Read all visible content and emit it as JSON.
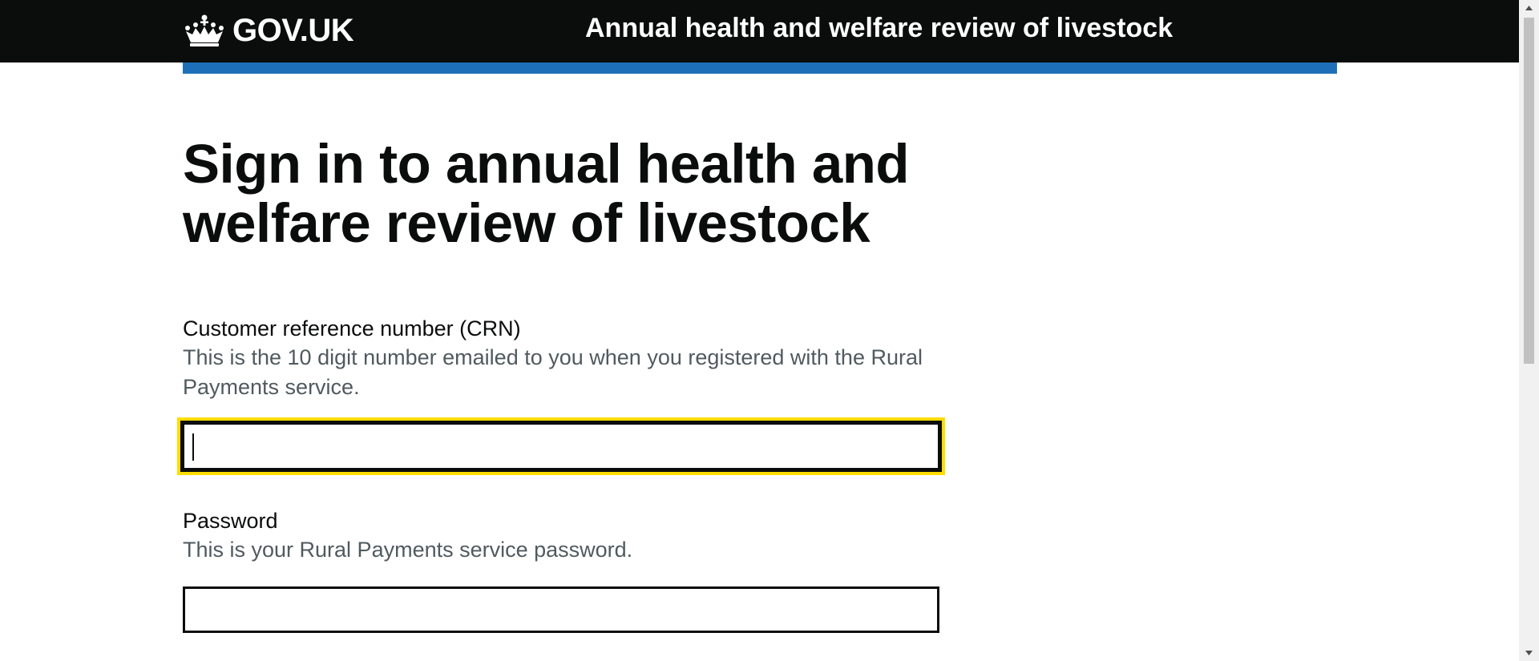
{
  "header": {
    "logo_text": "GOV.UK",
    "logo_icon": "crown-icon",
    "service_name": "Annual health and welfare review of livestock",
    "background_color": "#0b0c0c",
    "accent_bar_color": "#1d70b8"
  },
  "main": {
    "title": "Sign in to annual health and welfare review of livestock",
    "fields": [
      {
        "label": "Customer reference number (CRN)",
        "hint": "This is the 10 digit number emailed to you when you registered with the Rural Payments service.",
        "value": "",
        "focused": true
      },
      {
        "label": "Password",
        "hint": "This is your Rural Payments service password.",
        "value": "",
        "focused": false
      }
    ]
  },
  "colors": {
    "text": "#0b0c0c",
    "hint_text": "#505a5f",
    "focus": "#ffdd00"
  },
  "scrollbar": {
    "up_icon": "scroll-up-arrow-icon",
    "down_icon": "scroll-down-arrow-icon"
  }
}
